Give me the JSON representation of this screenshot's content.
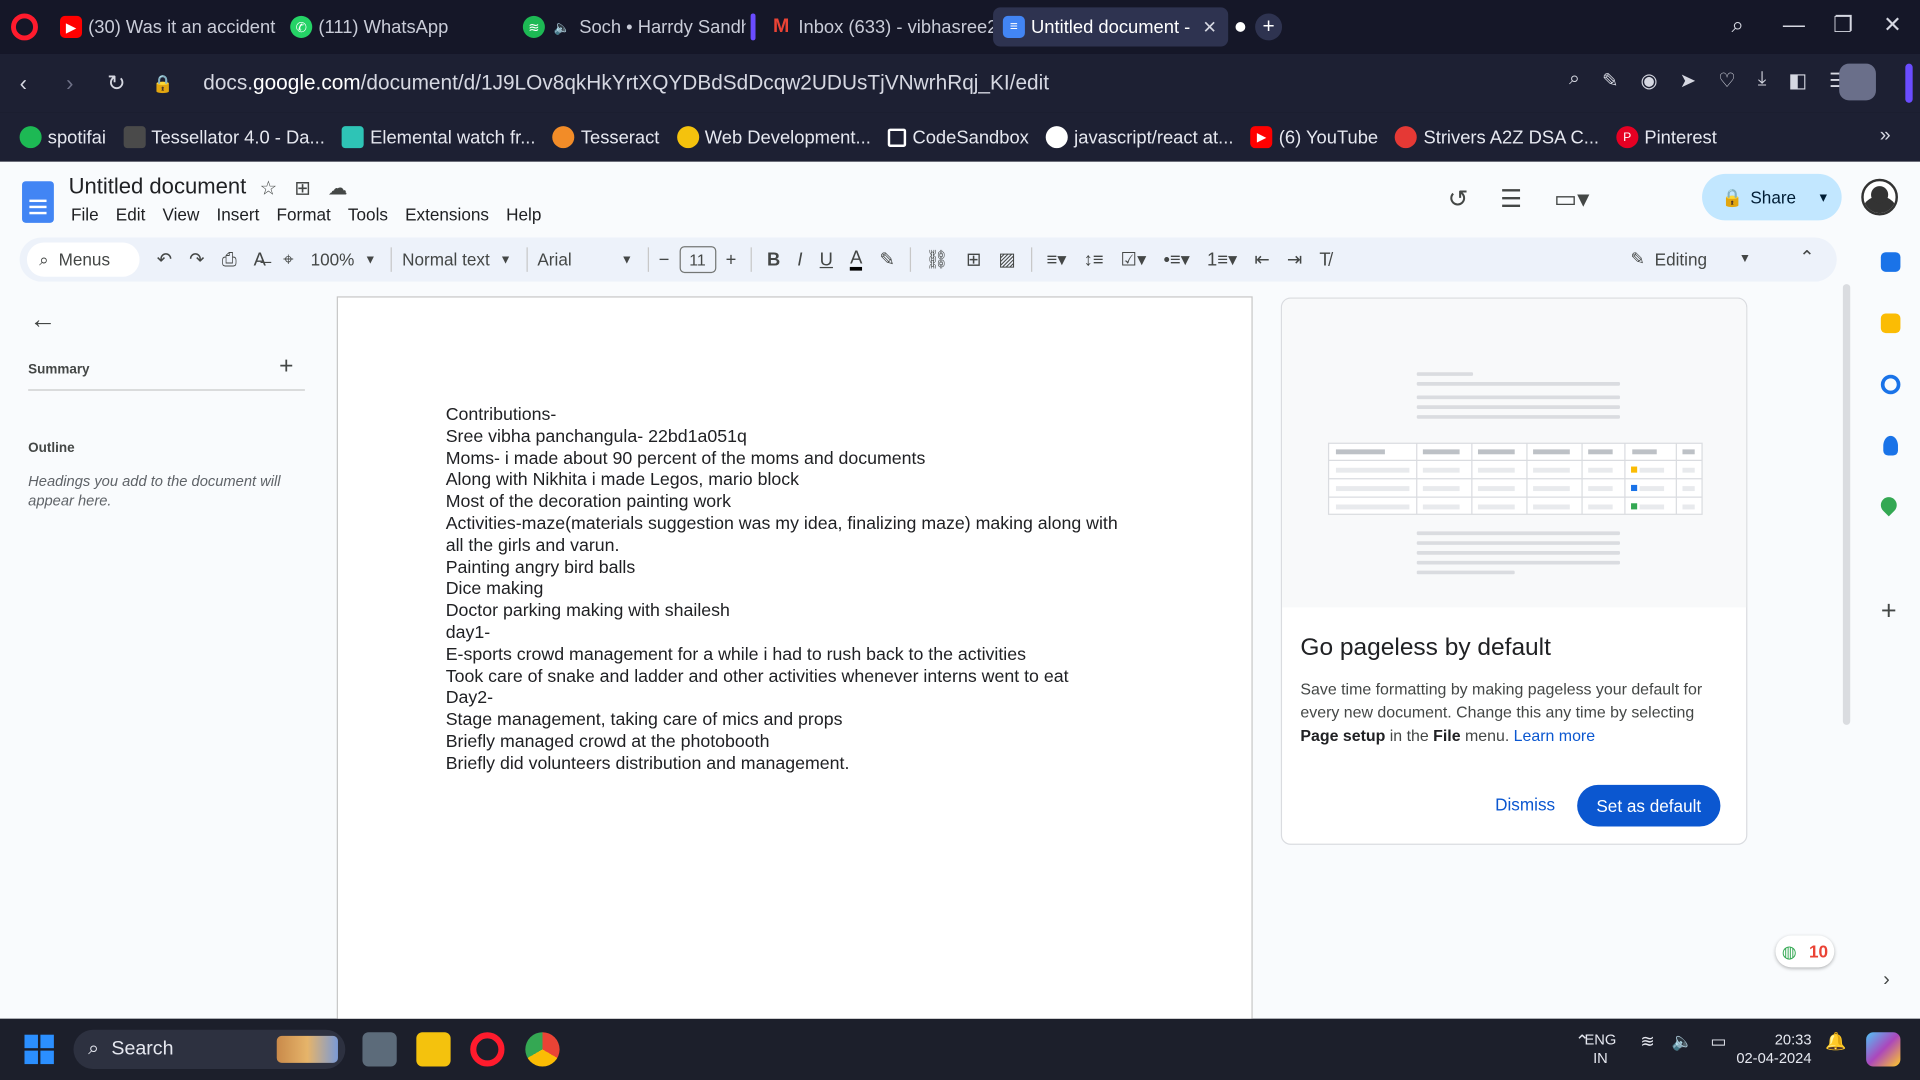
{
  "browser": {
    "tabs": [
      {
        "label": "(30) Was it an accident c",
        "icon": "youtube-icon",
        "color": "#ff0000"
      },
      {
        "label": "(111) WhatsApp",
        "icon": "whatsapp-icon",
        "color": "#25d366"
      },
      {
        "label": "Soch • Harrdy Sandh",
        "icon": "spotify-icon",
        "color": "#1db954"
      },
      {
        "label": "Inbox (633) - vibhasree2",
        "icon": "gmail-icon",
        "color": "#ea4335"
      },
      {
        "label": "Untitled document -",
        "icon": "docs-icon",
        "color": "#4285f4"
      }
    ],
    "url_prefix": "docs.",
    "url_domain": "google.com",
    "url_path": "/document/d/1J9LOv8qkHkYrtXQYDBdSdDcqw2UDUsTjVNwrhRqj_KI/edit",
    "bookmarks": [
      {
        "label": "spotifai",
        "color": "#1db954"
      },
      {
        "label": "Tessellator 4.0 - Da...",
        "color": "#4a4a4a"
      },
      {
        "label": "Elemental watch fr...",
        "color": "#2ec4b6"
      },
      {
        "label": "Tesseract",
        "color": "#f28c28"
      },
      {
        "label": "Web Development...",
        "color": "#f4c20d"
      },
      {
        "label": "CodeSandbox",
        "color": "#ffffff"
      },
      {
        "label": "javascript/react at...",
        "color": "#ffffff"
      },
      {
        "label": "(6) YouTube",
        "color": "#ff0000"
      },
      {
        "label": "Strivers A2Z DSA C...",
        "color": "#e53935"
      },
      {
        "label": "Pinterest",
        "color": "#e60023"
      }
    ]
  },
  "docs": {
    "title": "Untitled document",
    "menu": [
      "File",
      "Edit",
      "View",
      "Insert",
      "Format",
      "Tools",
      "Extensions",
      "Help"
    ],
    "share_label": "Share",
    "toolbar": {
      "search_label": "Menus",
      "zoom": "100%",
      "style": "Normal text",
      "font": "Arial",
      "font_size": "11",
      "mode": "Editing"
    },
    "outline": {
      "summary_label": "Summary",
      "outline_label": "Outline",
      "hint": "Headings you add to the document will appear here."
    },
    "card": {
      "title": "Go pageless by default",
      "text_1": "Save time formatting by making pageless your default for every new document. Change this any time by selecting ",
      "text_bold_1": "Page setup",
      "text_2": " in the ",
      "text_bold_2": "File",
      "text_3": " menu. ",
      "learn_more": "Learn more",
      "dismiss_label": "Dismiss",
      "set_default_label": "Set as default"
    },
    "badge_count": "10"
  },
  "document_lines": [
    "Contributions-",
    "Sree vibha panchangula- 22bd1a051q",
    "Moms- i made about 90 percent of the moms and documents",
    "Along with Nikhita i made Legos, mario block",
    "Most of the decoration painting work",
    "Activities-maze(materials suggestion was my idea, finalizing maze) making along with all the girls and varun.",
    "Painting angry bird balls",
    "Dice making",
    "Doctor parking making with shailesh",
    "day1-",
    "E-sports crowd management for a while i had to rush back to the activities",
    "Took care of snake and ladder and other activities whenever interns went to eat",
    "Day2-",
    "Stage management, taking care of mics and props",
    "Briefly managed crowd at the photobooth",
    "Briefly did volunteers distribution and management."
  ],
  "taskbar": {
    "search_label": "Search",
    "lang_1": "ENG",
    "lang_2": "IN",
    "time": "20:33",
    "date": "02-04-2024"
  }
}
